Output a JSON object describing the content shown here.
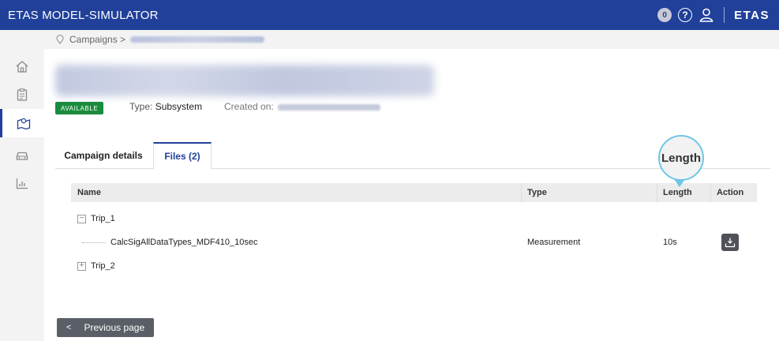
{
  "app": {
    "title": "ETAS MODEL-SIMULATOR",
    "brand": "ETAS",
    "notification_count": "0"
  },
  "breadcrumb": {
    "root": "Campaigns >",
    "separator": ">"
  },
  "campaign": {
    "status": "AVAILABLE",
    "type_label": "Type:",
    "type_value": "Subsystem",
    "created_label": "Created on:"
  },
  "tabs": [
    {
      "label": "Campaign details"
    },
    {
      "label": "Files (2)",
      "active": true
    }
  ],
  "table": {
    "headers": {
      "name": "Name",
      "type": "Type",
      "length": "Length",
      "action": "Action"
    },
    "rows": [
      {
        "kind": "group",
        "expander": "−",
        "name": "Trip_1",
        "type": "",
        "length": ""
      },
      {
        "kind": "file",
        "name": "CalcSigAllDataTypes_MDF410_10sec",
        "type": "Measurement",
        "length": "10s",
        "action": "download-icon"
      },
      {
        "kind": "group",
        "expander": "+",
        "name": "Trip_2",
        "type": "",
        "length": ""
      }
    ]
  },
  "callout": {
    "text": "Length"
  },
  "footer": {
    "prev_label": "Previous page",
    "prev_chevron": "<"
  },
  "colors": {
    "topbar": "#20409a",
    "status": "#1b8c3e",
    "callout_ring": "#6ec7e6"
  }
}
